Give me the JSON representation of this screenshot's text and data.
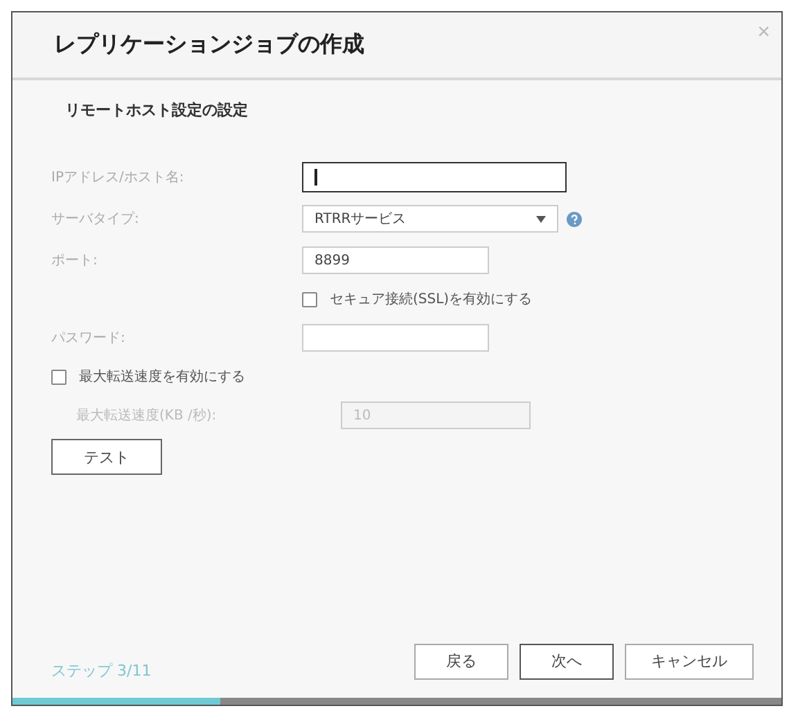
{
  "window": {
    "title": "レプリケーションジョブの作成",
    "close": "×"
  },
  "section_title": "リモートホスト設定の設定",
  "form": [
    {
      "kind": "text",
      "label": "IPアドレス/ホスト名:",
      "focused": true,
      "disabled": false
    },
    {
      "kind": "select",
      "label": "サーバタイプ:",
      "value": "RTRRサービス",
      "help": true,
      "disabled": false
    },
    {
      "kind": "text",
      "label": "ポート:",
      "value": "8899",
      "focused": false,
      "disabled": false
    },
    {
      "kind": "option",
      "label": "セキュア接続(SSL)を有効にする",
      "checked": false
    },
    {
      "kind": "text",
      "label": "パスワード:",
      "focused": false,
      "disabled": false
    },
    {
      "kind": "check",
      "label": "最大転送速度を有効にする",
      "checked": false
    },
    {
      "kind": "text",
      "label": "最大転送速度(KB /秒):",
      "value": "10",
      "focused": false,
      "disabled": true
    }
  ],
  "test_button": "テスト",
  "step": "ステップ 3/11",
  "progress": {
    "level": 0.27
  },
  "buttons": [
    {
      "label": "戻る",
      "focused": false
    },
    {
      "label": "次へ",
      "focused": true
    },
    {
      "label": "キャンセル",
      "focused": false
    }
  ]
}
